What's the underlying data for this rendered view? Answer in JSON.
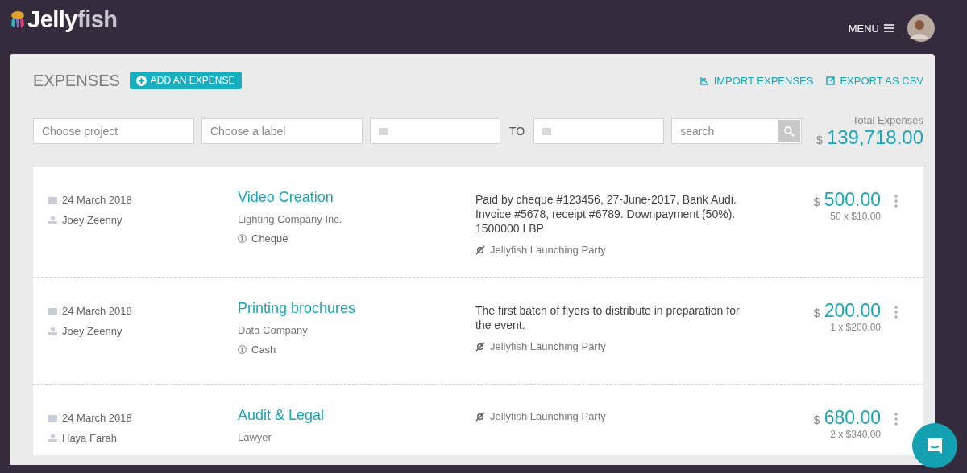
{
  "header": {
    "logo": [
      "Jelly",
      "fish"
    ],
    "menu": "MENU"
  },
  "toolbar": {
    "title": "EXPENSES",
    "add": "ADD AN EXPENSE",
    "import": "IMPORT EXPENSES",
    "export": "EXPORT AS CSV"
  },
  "filters": {
    "project": {
      "placeholder": "Choose project"
    },
    "label": {
      "placeholder": "Choose a label"
    },
    "to": "TO",
    "search": {
      "placeholder": "search"
    }
  },
  "total": {
    "label": "Total Expenses",
    "currency": "$",
    "amount": "139,718.00"
  },
  "expenses": [
    {
      "date": "24 March 2018",
      "person": "Joey Zeenny",
      "title": "Video Creation",
      "vendor": "Lighting Company Inc.",
      "method": "Cheque",
      "description": "Paid by cheque #123456, 27-June-2017, Bank Audi. Invoice #5678, receipt #6789. Downpayment (50%). 1500000 LBP",
      "project": "Jellyfish Launching Party",
      "currency": "$",
      "amount": "500.00",
      "breakdown": "50 x $10.00"
    },
    {
      "date": "24 March 2018",
      "person": "Joey Zeenny",
      "title": "Printing brochures",
      "vendor": "Data Company",
      "method": "Cash",
      "description": "The first batch of flyers to distribute in preparation for the event.",
      "project": "Jellyfish Launching Party",
      "currency": "$",
      "amount": "200.00",
      "breakdown": "1 x $200.00"
    },
    {
      "date": "24 March 2018",
      "person": "Haya Farah",
      "title": "Audit & Legal",
      "vendor": "Lawyer",
      "project": "Jellyfish Launching Party",
      "currency": "$",
      "amount": "680.00",
      "breakdown": "2 x $340.00"
    }
  ]
}
